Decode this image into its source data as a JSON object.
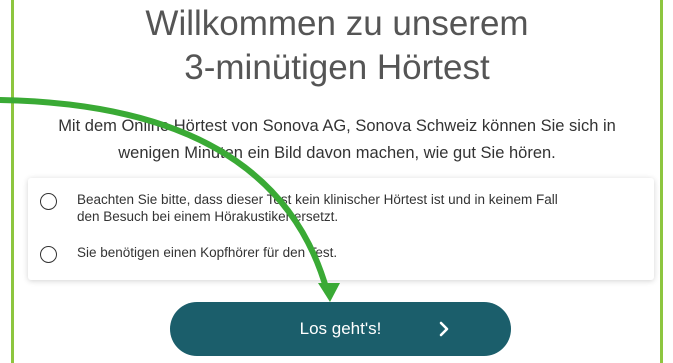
{
  "heading": {
    "line1": "Willkommen zu unserem",
    "line2": "3-minütigen Hörtest"
  },
  "intro": {
    "line1": "Mit dem Online Hörtest von Sonova AG, Sonova Schweiz können Sie sich in",
    "line2": "wenigen Minuten ein Bild davon machen, wie gut Sie hören."
  },
  "checklist": [
    {
      "line1": "Beachten Sie bitte, dass dieser Test kein klinischer Hörtest ist und in keinem Fall",
      "line2": "den Besuch bei einem Hörakustiker ersetzt."
    },
    {
      "line1": "Sie benötigen einen Kopfhörer für den Test."
    }
  ],
  "cta": {
    "label": "Los geht's!",
    "icon": "chevron-right-icon"
  },
  "colors": {
    "frame_border": "#8dc63f",
    "annotation_arrow": "#3aaa35",
    "button_bg": "#1b5e6b"
  }
}
